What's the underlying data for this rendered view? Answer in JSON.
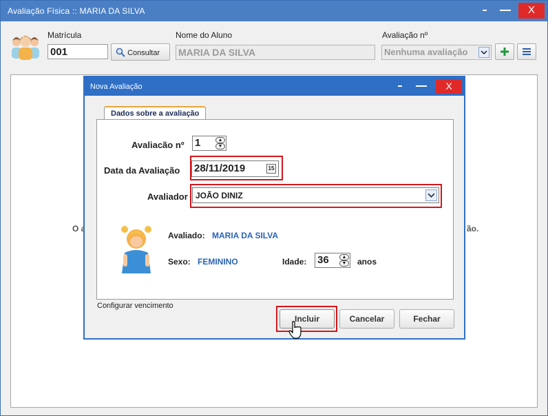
{
  "window": {
    "title": "Avaliação Física  ::  MARIA DA SILVA",
    "close_label": "X"
  },
  "header": {
    "matricula_label": "Matrícula",
    "matricula_value": "001",
    "consultar_label": "Consultar",
    "nome_label": "Nome do Aluno",
    "nome_value": "MARIA DA SILVA",
    "avaliacao_label": "Avaliação nº",
    "avaliacao_value": "Nenhuma avaliação",
    "add_icon": "plus-icon",
    "menu_icon": "hamburger-icon"
  },
  "background": {
    "msg_left": "O a",
    "msg_right": "ão."
  },
  "dialog": {
    "title": "Nova Avaliação",
    "close_label": "X",
    "tab_label": "Dados sobre a avaliação",
    "avaliacao_no_label": "Avaliacão nº",
    "avaliacao_no_value": "1",
    "data_label": "Data da Avaliação",
    "data_value": "28/11/2019",
    "avaliador_label": "Avaliador",
    "avaliador_value": "JOÃO DINIZ",
    "avaliado_label": "Avaliado:",
    "avaliado_value": "MARIA DA SILVA",
    "sexo_label": "Sexo:",
    "sexo_value": "FEMININO",
    "idade_label": "Idade:",
    "idade_value": "36",
    "anos_label": "anos",
    "config_label": "Configurar vencimento",
    "incluir_label": "Incluir",
    "cancelar_label": "Cancelar",
    "fechar_label": "Fechar"
  },
  "colors": {
    "title_bar": "#4a7fc4",
    "dialog_title_bar": "#2f6fc5",
    "close_button": "#e02a2a",
    "highlight": "#d4161c",
    "value_text": "#2a64b8"
  }
}
